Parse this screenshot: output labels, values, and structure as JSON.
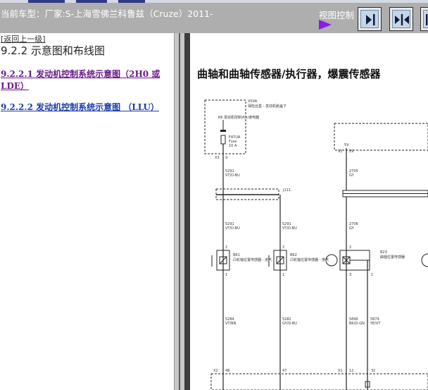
{
  "header": {
    "car_title": "当前车型：厂家:S-上海雪佛兰科鲁兹（Cruze）2011-",
    "view_control_label": "视图控制",
    "colors": {
      "header_bg": "#aeaeae",
      "accent_arrow": "#8d18e8",
      "top_strip": "#2d3a86"
    },
    "buttons": [
      {
        "name": "view-right-panel-button",
        "icon": "arrow-right-bar-icon"
      },
      {
        "name": "view-split-button",
        "icon": "split-arrows-icon"
      },
      {
        "name": "view-left-panel-button",
        "icon": "arrow-left-bar-icon"
      }
    ]
  },
  "left": {
    "back_link": "[返回上一级]",
    "section_title": "9.2.2 示意图和布线图",
    "toc": [
      {
        "label": "9.2.2.1 发动机控制系统示意图（2H0 或 LDE）",
        "visited": true
      },
      {
        "label": "9.2.2.2 发动机控制系统示意图 （LLU）",
        "visited": false
      }
    ]
  },
  "diagram": {
    "title": "曲轴和曲轴传感器/执行器，爆震传感器",
    "labels": {
      "x50a": "X50A",
      "x50a_desc": "保险丝盒 - 发动机舱盖下",
      "k-relay": "K6 发动机控制点火继电器",
      "fuse_id": "F47UA",
      "fuse_word": "Fuse",
      "fuse_amp": "10 A",
      "x3_left": "X3",
      "x3_pin": "9",
      "wire_5291_a": "5291",
      "wire_color_a": "VT/D-BU",
      "j111": "J111",
      "wire_5291_b": "5291",
      "wire_color_b": "VT/D-BU",
      "wire_5291_c": "5291",
      "wire_color_c": "VT/D-BU",
      "wire_2705": "2705",
      "wire_gy": "GY",
      "wire_2706": "2706",
      "wire_gy2": "GY",
      "sv": "5V",
      "x1_top": "X1",
      "pin_29": "29",
      "b61": "B61",
      "b61_desc": "凸轮轴位置传感器 - 进气",
      "b62": "B62",
      "b62_desc": "凸轮轴位置传感器 - 排气",
      "b23": "B23",
      "b23_desc": "曲轴位置传感器",
      "pin2_a": "2",
      "pin1_a": "1",
      "pin2_b": "2",
      "pin1_b": "1",
      "pin2_c": "2",
      "pin3_c": "3",
      "pin1_c": "1",
      "wire_5284": "5284",
      "wire_5284_c": "VT/BN",
      "wire_5282": "5282",
      "wire_5282_c": "GY/D-BU",
      "wire_5890": "5890",
      "wire_5890_c": "BK/D-GN",
      "wire_5879": "5879",
      "wire_5879_c": "YE/VT",
      "x2": "X2",
      "pin_48": "48",
      "pin_47": "47",
      "x1_bot": "X1",
      "pin_12": "12",
      "pin_32": "32"
    }
  }
}
